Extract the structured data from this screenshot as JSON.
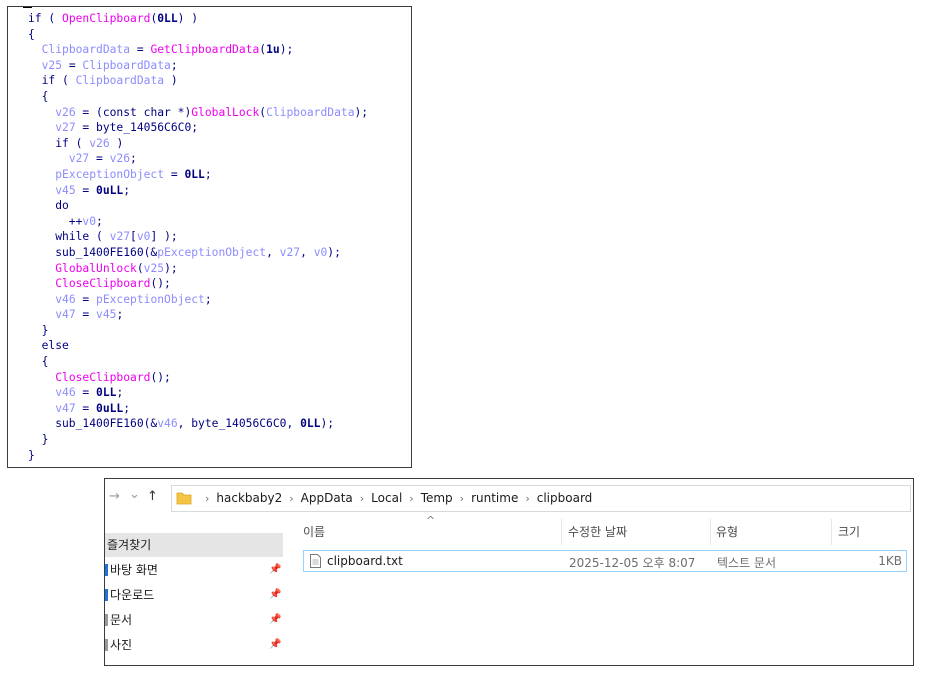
{
  "code": {
    "lines": [
      [
        [
          "kw",
          "if ( "
        ],
        [
          "fn",
          "OpenClipboard"
        ],
        [
          "pl",
          "("
        ],
        [
          "num",
          "0LL"
        ],
        [
          "pl",
          ") )"
        ]
      ],
      [
        [
          "pl",
          "{"
        ]
      ],
      [
        [
          "pl",
          "  "
        ],
        [
          "var",
          "ClipboardData"
        ],
        [
          "pl",
          " = "
        ],
        [
          "fn",
          "GetClipboardData"
        ],
        [
          "pl",
          "("
        ],
        [
          "num",
          "1u"
        ],
        [
          "pl",
          ");"
        ]
      ],
      [
        [
          "pl",
          "  "
        ],
        [
          "var",
          "v25"
        ],
        [
          "pl",
          " = "
        ],
        [
          "var",
          "ClipboardData"
        ],
        [
          "pl",
          ";"
        ]
      ],
      [
        [
          "pl",
          "  "
        ],
        [
          "kw",
          "if ( "
        ],
        [
          "var",
          "ClipboardData"
        ],
        [
          "pl",
          " )"
        ]
      ],
      [
        [
          "pl",
          "  {"
        ]
      ],
      [
        [
          "pl",
          "    "
        ],
        [
          "var",
          "v26"
        ],
        [
          "pl",
          " = (const char *)"
        ],
        [
          "fn",
          "GlobalLock"
        ],
        [
          "pl",
          "("
        ],
        [
          "var",
          "ClipboardData"
        ],
        [
          "pl",
          ");"
        ]
      ],
      [
        [
          "pl",
          "    "
        ],
        [
          "var",
          "v27"
        ],
        [
          "pl",
          " = byte_14056C6C0;"
        ]
      ],
      [
        [
          "pl",
          "    "
        ],
        [
          "kw",
          "if ( "
        ],
        [
          "var",
          "v26"
        ],
        [
          "pl",
          " )"
        ]
      ],
      [
        [
          "pl",
          "      "
        ],
        [
          "var",
          "v27"
        ],
        [
          "pl",
          " = "
        ],
        [
          "var",
          "v26"
        ],
        [
          "pl",
          ";"
        ]
      ],
      [
        [
          "pl",
          "    "
        ],
        [
          "var",
          "pExceptionObject"
        ],
        [
          "pl",
          " = "
        ],
        [
          "num",
          "0LL"
        ],
        [
          "pl",
          ";"
        ]
      ],
      [
        [
          "pl",
          "    "
        ],
        [
          "var",
          "v45"
        ],
        [
          "pl",
          " = "
        ],
        [
          "num",
          "0uLL"
        ],
        [
          "pl",
          ";"
        ]
      ],
      [
        [
          "pl",
          "    "
        ],
        [
          "kw",
          "do"
        ]
      ],
      [
        [
          "pl",
          "      ++"
        ],
        [
          "var",
          "v0"
        ],
        [
          "pl",
          ";"
        ]
      ],
      [
        [
          "pl",
          "    "
        ],
        [
          "kw",
          "while ( "
        ],
        [
          "var",
          "v27"
        ],
        [
          "pl",
          "["
        ],
        [
          "var",
          "v0"
        ],
        [
          "pl",
          "] );"
        ]
      ],
      [
        [
          "pl",
          "    sub_1400FE160(&"
        ],
        [
          "var",
          "pExceptionObject"
        ],
        [
          "pl",
          ", "
        ],
        [
          "var",
          "v27"
        ],
        [
          "pl",
          ", "
        ],
        [
          "var",
          "v0"
        ],
        [
          "pl",
          ");"
        ]
      ],
      [
        [
          "pl",
          "    "
        ],
        [
          "fn",
          "GlobalUnlock"
        ],
        [
          "pl",
          "("
        ],
        [
          "var",
          "v25"
        ],
        [
          "pl",
          ");"
        ]
      ],
      [
        [
          "pl",
          "    "
        ],
        [
          "fn",
          "CloseClipboard"
        ],
        [
          "pl",
          "();"
        ]
      ],
      [
        [
          "pl",
          "    "
        ],
        [
          "var",
          "v46"
        ],
        [
          "pl",
          " = "
        ],
        [
          "var",
          "pExceptionObject"
        ],
        [
          "pl",
          ";"
        ]
      ],
      [
        [
          "pl",
          "    "
        ],
        [
          "var",
          "v47"
        ],
        [
          "pl",
          " = "
        ],
        [
          "var",
          "v45"
        ],
        [
          "pl",
          ";"
        ]
      ],
      [
        [
          "pl",
          "  }"
        ]
      ],
      [
        [
          "pl",
          "  "
        ],
        [
          "kw",
          "else"
        ]
      ],
      [
        [
          "pl",
          "  {"
        ]
      ],
      [
        [
          "pl",
          "    "
        ],
        [
          "fn",
          "CloseClipboard"
        ],
        [
          "pl",
          "();"
        ]
      ],
      [
        [
          "pl",
          "    "
        ],
        [
          "var",
          "v46"
        ],
        [
          "pl",
          " = "
        ],
        [
          "num",
          "0LL"
        ],
        [
          "pl",
          ";"
        ]
      ],
      [
        [
          "pl",
          "    "
        ],
        [
          "var",
          "v47"
        ],
        [
          "pl",
          " = "
        ],
        [
          "num",
          "0uLL"
        ],
        [
          "pl",
          ";"
        ]
      ],
      [
        [
          "pl",
          "    sub_1400FE160(&"
        ],
        [
          "var",
          "v46"
        ],
        [
          "pl",
          ", byte_14056C6C0, "
        ],
        [
          "num",
          "0LL"
        ],
        [
          "pl",
          ");"
        ]
      ],
      [
        [
          "pl",
          "  }"
        ]
      ],
      [
        [
          "pl",
          "}"
        ]
      ]
    ]
  },
  "explorer": {
    "nav": {
      "back": "→",
      "dropdown": "⌄",
      "up": "↑"
    },
    "breadcrumb": [
      "hackbaby2",
      "AppData",
      "Local",
      "Temp",
      "runtime",
      "clipboard"
    ],
    "sidebar": {
      "quick_access": "즐겨찾기",
      "items": [
        {
          "label": "바탕 화면",
          "pin": "📌",
          "color": "#1e73d8"
        },
        {
          "label": "다운로드",
          "pin": "📌",
          "color": "#1e73d8"
        },
        {
          "label": "문서",
          "pin": "📌",
          "color": "#9a9a9a"
        },
        {
          "label": "사진",
          "pin": "📌",
          "color": "#9a9a9a"
        }
      ]
    },
    "columns": {
      "name": "이름",
      "modified": "수정한 날짜",
      "type": "유형",
      "size": "크기"
    },
    "file": {
      "name": "clipboard.txt",
      "modified": "2025-12-05 오후 8:07",
      "type": "텍스트 문서",
      "size": "1KB"
    },
    "colors": {
      "selection_border": "#99d1ff",
      "folder": "#f4c542"
    }
  }
}
